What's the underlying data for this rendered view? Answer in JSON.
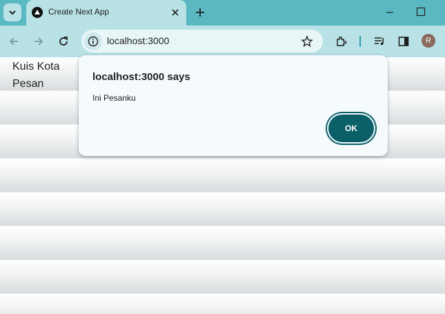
{
  "browser": {
    "tab": {
      "title": "Create Next App"
    },
    "address": {
      "url": "localhost:3000"
    },
    "profile_initial": "R",
    "colors": {
      "tabstrip": "#5ab8c2",
      "toolbar": "#b9e2e6",
      "accent": "#0b5f68"
    }
  },
  "page": {
    "lines": [
      "Kuis Kota",
      "Pesan"
    ]
  },
  "dialog": {
    "title": "localhost:3000 says",
    "message": "Ini Pesanku",
    "ok_label": "OK"
  },
  "icons": [
    "tab-search-icon",
    "nextjs-favicon-icon",
    "close-tab-icon",
    "new-tab-icon",
    "minimize-icon",
    "maximize-icon",
    "back-icon",
    "forward-icon",
    "reload-icon",
    "site-info-icon",
    "bookmark-star-icon",
    "extensions-icon",
    "media-queue-icon",
    "side-panel-icon"
  ]
}
